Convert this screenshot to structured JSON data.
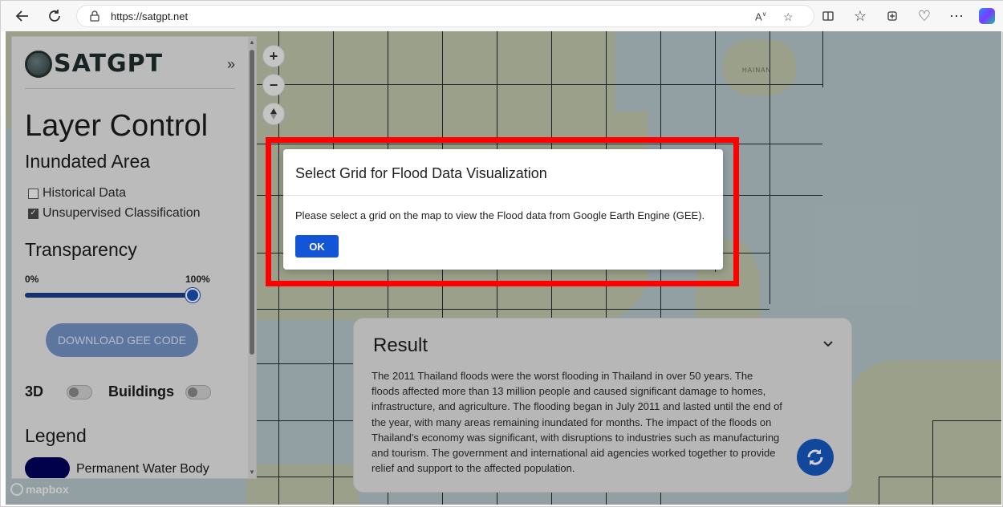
{
  "browser": {
    "url": "https://satgpt.net"
  },
  "sidebar": {
    "logo_text": "SATGPT",
    "collapse_glyph": "»",
    "title": "Layer Control",
    "section_inundated": "Inundated Area",
    "check_historical": "Historical Data",
    "check_unsupervised": "Unsupervised Classification",
    "section_transparency": "Transparency",
    "pct_min": "0%",
    "pct_max": "100%",
    "transparency_value": 1.0,
    "download_label": "DOWNLOAD GEE CODE",
    "toggle_3d": "3D",
    "toggle_buildings": "Buildings",
    "section_legend": "Legend",
    "legend_permanent": "Permanent Water Body"
  },
  "map": {
    "label_hainan": "HAINAN",
    "mapbox": "mapbox"
  },
  "modal": {
    "title": "Select Grid for Flood Data Visualization",
    "body": "Please select a grid on the map to view the Flood data from Google Earth Engine (GEE).",
    "ok_label": "OK"
  },
  "result": {
    "title": "Result",
    "text": "The 2011 Thailand floods were the worst flooding in Thailand in over 50 years. The floods affected more than 13 million people and caused significant damage to homes, infrastructure, and agriculture. The flooding began in July 2011 and lasted until the end of the year, with many areas remaining inundated for months. The impact of the floods on Thailand's economy was significant, with disruptions to industries such as manufacturing and tourism. The government and international aid agencies worked together to provide relief and support to the affected population."
  },
  "colors": {
    "accent": "#1255d6",
    "highlight": "#ff0000",
    "legend_permanent": "#00005c"
  }
}
